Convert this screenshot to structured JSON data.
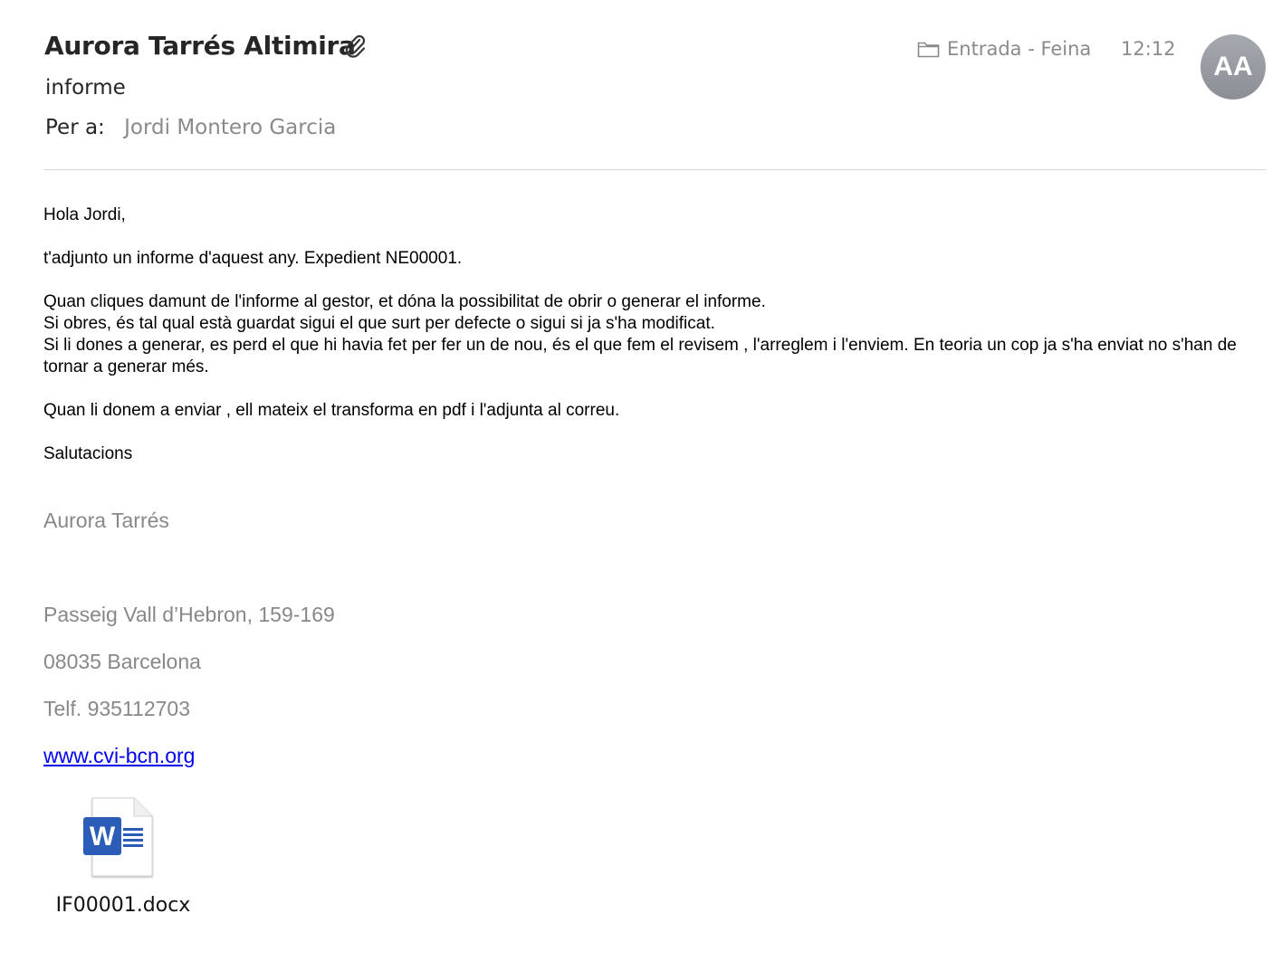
{
  "header": {
    "sender": "Aurora Tarrés Altimira",
    "subject": "informe",
    "to_label": "Per a:",
    "to_name": "Jordi Montero Garcia",
    "folder": "Entrada - Feina",
    "time": "12:12",
    "avatar_initials": "AA"
  },
  "body": {
    "greeting": "Hola Jordi,",
    "p1": "t'adjunto un informe d'aquest any. Expedient NE00001.",
    "p2_l1": "Quan cliques damunt de l'informe al gestor, et dóna la possibilitat de obrir o generar el informe.",
    "p2_l2": "Si obres, és tal qual està guardat sigui el que surt per defecte o sigui si ja s'ha modificat.",
    "p2_l3": "Si li dones a generar, es perd  el que hi  havia fet per fer un de nou, és el que fem el revisem , l'arreglem i l'enviem. En teoria un cop ja s'ha enviat no s'han de tornar a generar més.",
    "p3": "Quan li donem a enviar , ell mateix el transforma en pdf i l'adjunta al correu.",
    "closing": "Salutacions"
  },
  "signature": {
    "name": "Aurora Tarrés",
    "address": "Passeig Vall d’Hebron, 159-169",
    "city": "08035 Barcelona",
    "phone": "Telf. 935112703",
    "website": "www.cvi-bcn.org"
  },
  "attachment": {
    "filename": "IF00001.docx",
    "icon": "word-document-icon"
  },
  "colors": {
    "muted": "#8a8a8a",
    "link": "#0000ee",
    "word_blue": "#2b5cb8"
  }
}
